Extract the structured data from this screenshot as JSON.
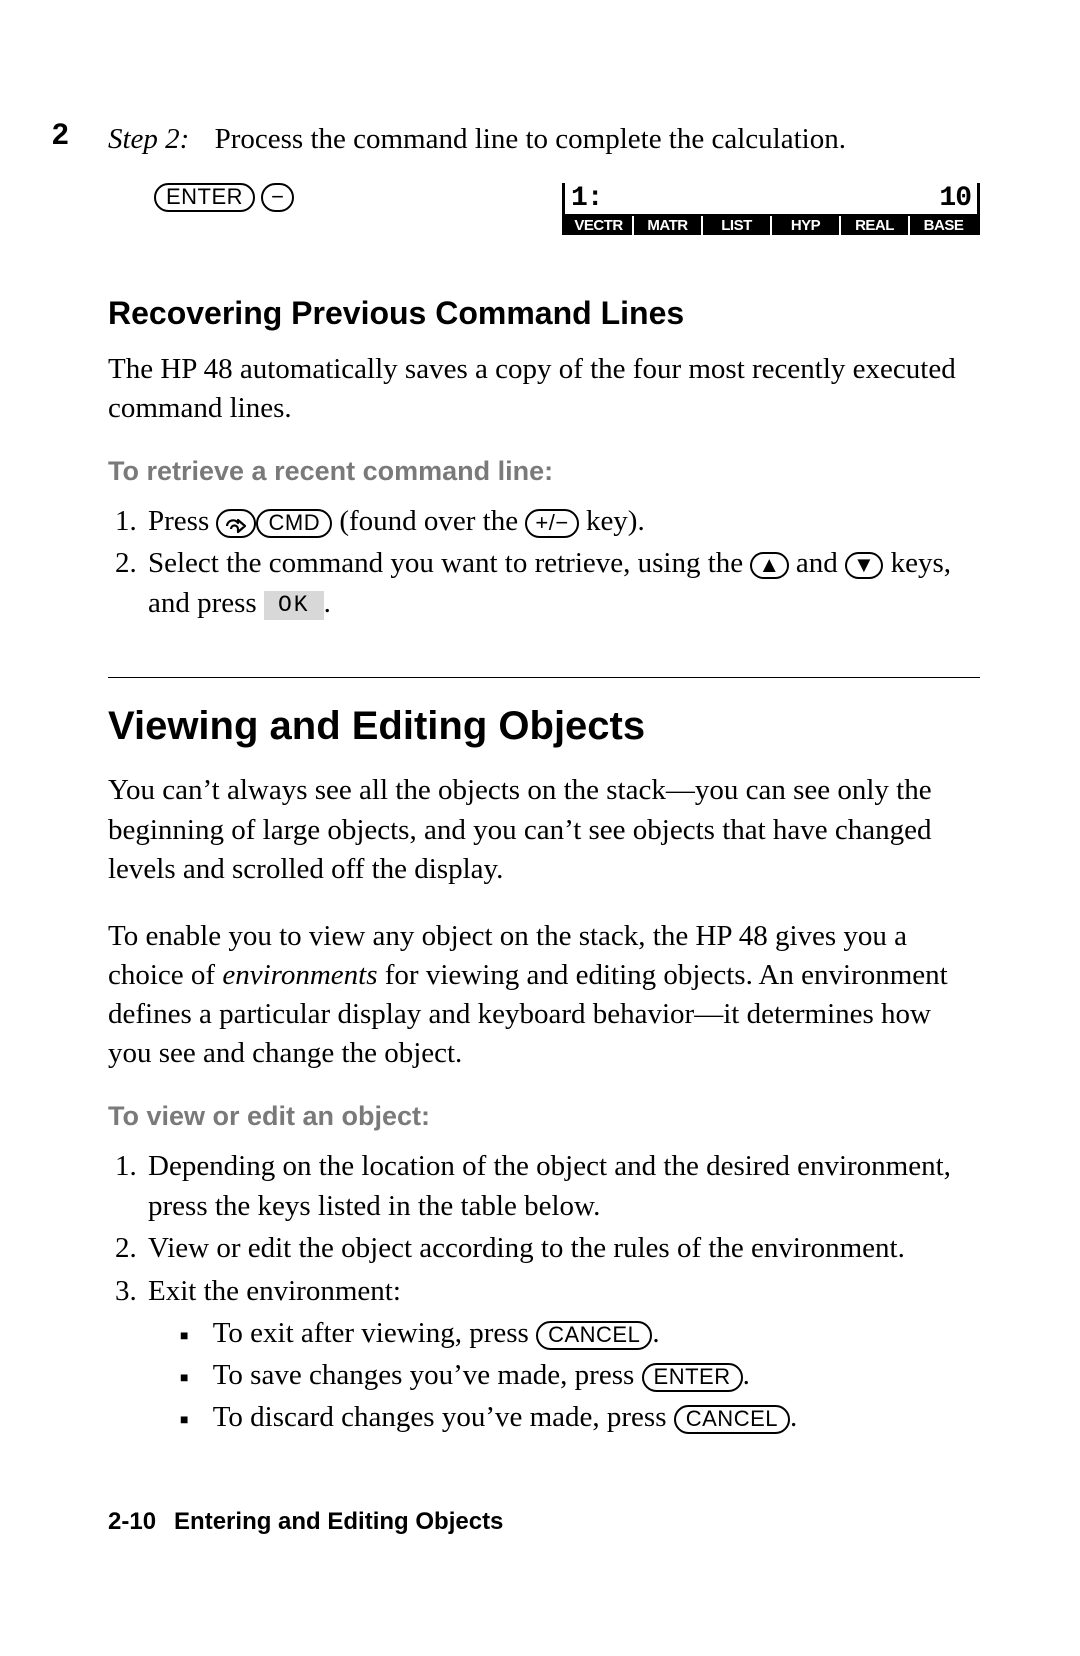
{
  "margin_number": "2",
  "step": {
    "label": "Step 2:",
    "text": "Process the command line to complete the calculation.",
    "keys": {
      "enter": "ENTER",
      "minus": "−"
    }
  },
  "display": {
    "level": "1:",
    "value": "10",
    "menu": [
      "VECTR",
      "MATR",
      "LIST",
      "HYP",
      "REAL",
      "BASE"
    ]
  },
  "recover": {
    "heading": "Recovering Previous Command Lines",
    "para": "The HP 48 automatically saves a copy of the four most recently executed command lines.",
    "sub": "To retrieve a recent command line:",
    "s1a": "Press ",
    "s1_cmd": "CMD",
    "s1b": " (found over the ",
    "s1_pm": "+/−",
    "s1c": " key).",
    "s2a": "Select the command you want to retrieve, using the ",
    "s2_up": "▲",
    "s2b": " and ",
    "s2_down": "▼",
    "s2c": " keys, and press ",
    "s2_ok": "OK",
    "s2d": "."
  },
  "view": {
    "heading": "Viewing and Editing Objects",
    "p1": "You can’t always see all the objects on the stack—you can see only the beginning of large objects, and you can’t see objects that have changed levels and scrolled off the display.",
    "p2a": "To enable you to view any object on the stack, the HP 48 gives you a choice of ",
    "p2_em": "environments",
    "p2b": " for viewing and editing objects. An environment defines a particular display and keyboard behavior—it determines how you see and change the object.",
    "sub": "To view or edit an object:",
    "s1": "Depending on the location of the object and the desired environment, press the keys listed in the table below.",
    "s2": "View or edit the object according to the rules of the environment.",
    "s3_intro": "Exit the environment:",
    "b1a": "To exit after viewing, press ",
    "b1_key": "CANCEL",
    "b1b": ".",
    "b2a": "To save changes you’ve made, press ",
    "b2_key": "ENTER",
    "b2b": ".",
    "b3a": "To discard changes you’ve made, press ",
    "b3_key": "CANCEL",
    "b3b": "."
  },
  "footer": {
    "page": "2-10",
    "title": "Entering and Editing Objects"
  }
}
